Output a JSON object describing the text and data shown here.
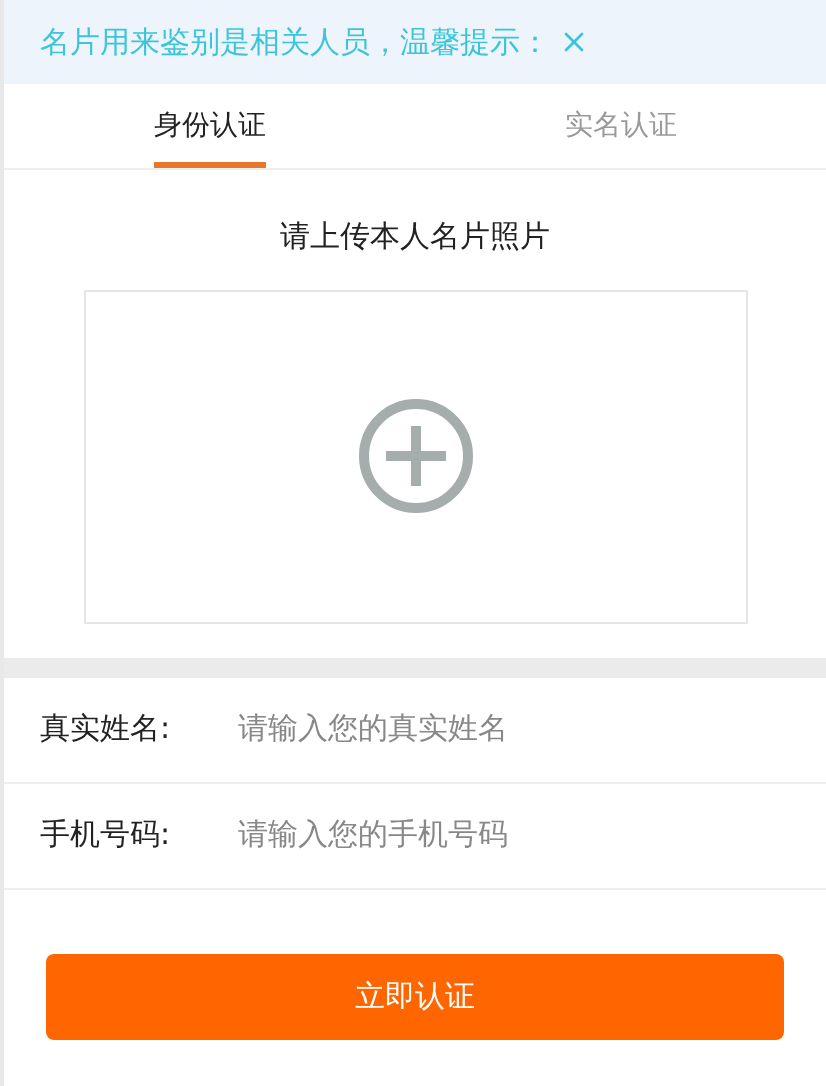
{
  "notice": {
    "text": "名片用来鉴别是相关人员，温馨提示："
  },
  "tabs": [
    {
      "label": "身份认证",
      "selected": true
    },
    {
      "label": "实名认证",
      "selected": false
    }
  ],
  "upload": {
    "title": "请上传本人名片照片"
  },
  "fields": [
    {
      "label": "真实姓名:",
      "placeholder": "请输入您的真实姓名"
    },
    {
      "label": "手机号码:",
      "placeholder": "请输入您的手机号码"
    }
  ],
  "submit": {
    "label": "立即认证"
  }
}
